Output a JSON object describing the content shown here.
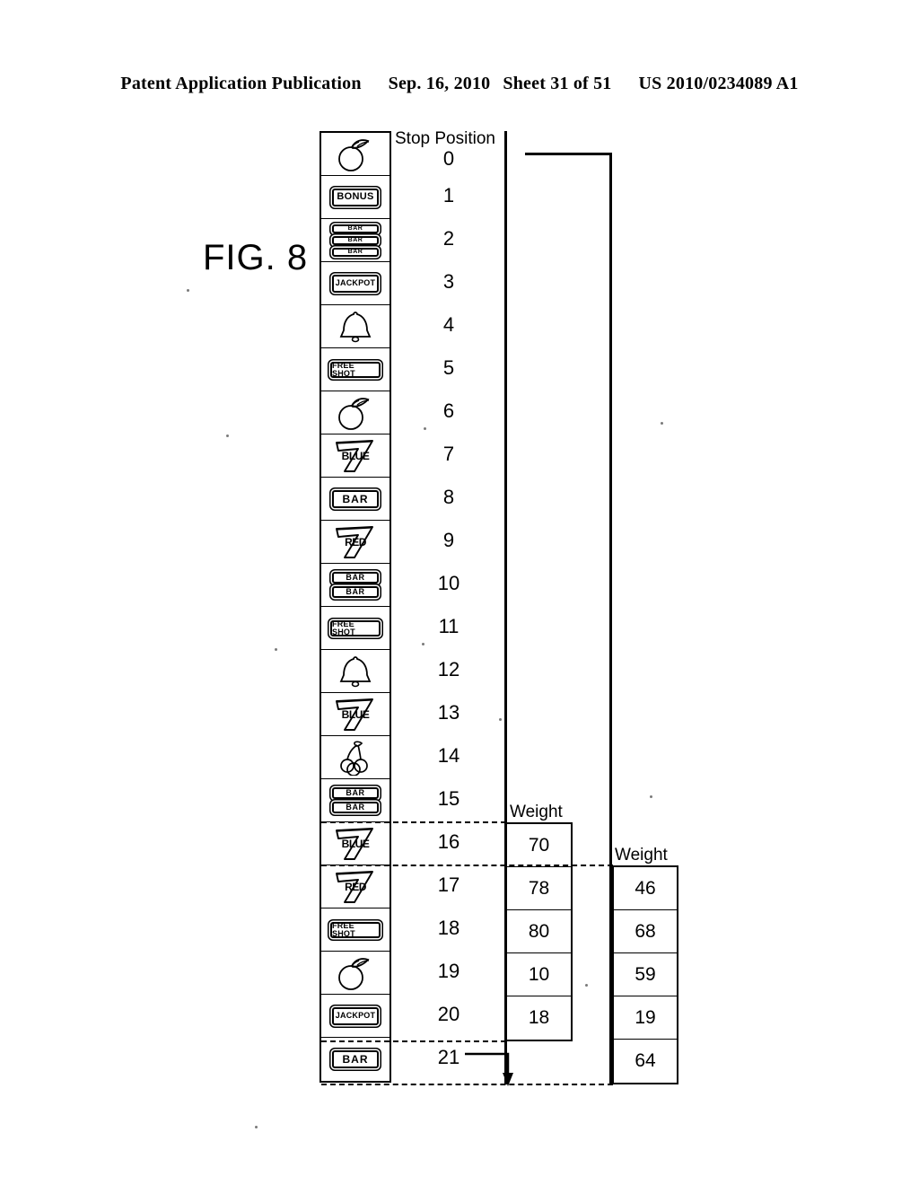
{
  "header": {
    "publication": "Patent Application Publication",
    "date": "Sep. 16, 2010",
    "sheet": "Sheet 31 of 51",
    "number": "US 2010/0234089 A1"
  },
  "figure": {
    "label": "FIG. 8"
  },
  "reel": {
    "stop_position_header": "Stop Position",
    "symbols": [
      {
        "position": "0",
        "symbol": "orange",
        "text": ""
      },
      {
        "position": "1",
        "symbol": "bonus",
        "text": "BONUS"
      },
      {
        "position": "2",
        "symbol": "bar-triple",
        "text": "BAR"
      },
      {
        "position": "3",
        "symbol": "jackpot",
        "text": "JACKPOT"
      },
      {
        "position": "4",
        "symbol": "bell",
        "text": ""
      },
      {
        "position": "5",
        "symbol": "free-shot",
        "text": "FREE SHOT"
      },
      {
        "position": "6",
        "symbol": "orange",
        "text": ""
      },
      {
        "position": "7",
        "symbol": "seven-blue",
        "text": "BLUE"
      },
      {
        "position": "8",
        "symbol": "bar-single",
        "text": "BAR"
      },
      {
        "position": "9",
        "symbol": "seven-red",
        "text": "RED"
      },
      {
        "position": "10",
        "symbol": "bar-double",
        "text": "BAR"
      },
      {
        "position": "11",
        "symbol": "free-shot",
        "text": "FREE SHOT"
      },
      {
        "position": "12",
        "symbol": "bell",
        "text": ""
      },
      {
        "position": "13",
        "symbol": "seven-blue",
        "text": "BLUE"
      },
      {
        "position": "14",
        "symbol": "cherries",
        "text": ""
      },
      {
        "position": "15",
        "symbol": "bar-double",
        "text": "BAR"
      },
      {
        "position": "16",
        "symbol": "seven-blue",
        "text": "BLUE"
      },
      {
        "position": "17",
        "symbol": "seven-red",
        "text": "RED"
      },
      {
        "position": "18",
        "symbol": "free-shot",
        "text": "FREE SHOT"
      },
      {
        "position": "19",
        "symbol": "orange",
        "text": ""
      },
      {
        "position": "20",
        "symbol": "jackpot",
        "text": "JACKPOT"
      },
      {
        "position": "21",
        "symbol": "bar-single",
        "text": "BAR"
      }
    ]
  },
  "weight_table_1": {
    "label": "Weight",
    "values": [
      "70",
      "78",
      "80",
      "10",
      "18"
    ]
  },
  "weight_table_2": {
    "label": "Weight",
    "values": [
      "46",
      "68",
      "59",
      "19",
      "64"
    ]
  },
  "colors": {
    "ink": "#000000",
    "paper": "#ffffff"
  }
}
